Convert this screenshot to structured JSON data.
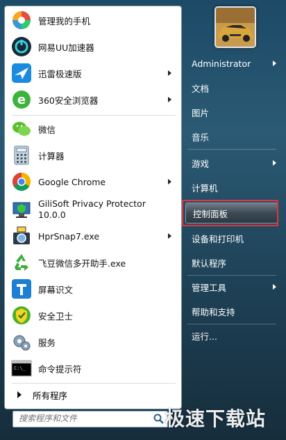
{
  "programs": [
    {
      "label": "管理我的手机",
      "icon": "colorful-circle-icon"
    },
    {
      "label": "网易UU加速器",
      "icon": "uu-accelerator-icon"
    },
    {
      "label": "迅雷极速版",
      "icon": "thunder-bird-icon",
      "submenu": true
    },
    {
      "label": "360安全浏览器",
      "icon": "ie-e-icon",
      "submenu": true
    },
    {
      "label": "微信",
      "icon": "wechat-icon"
    },
    {
      "label": "计算器",
      "icon": "calculator-icon"
    },
    {
      "label": "Google Chrome",
      "icon": "chrome-icon",
      "submenu": true
    },
    {
      "label": "GiliSoft Privacy Protector",
      "label2": "10.0.0",
      "icon": "privacy-protector-icon"
    },
    {
      "label": "HprSnap7.exe",
      "icon": "hypersnap-icon",
      "submenu": true
    },
    {
      "label": "飞豆微信多开助手.exe",
      "icon": "recycle-icon"
    },
    {
      "label": "屏幕识文",
      "icon": "t-text-icon"
    },
    {
      "label": "安全卫士",
      "icon": "security-guard-icon"
    },
    {
      "label": "服务",
      "icon": "gear-service-icon"
    },
    {
      "label": "命令提示符",
      "icon": "cmd-icon"
    }
  ],
  "all_programs": "所有程序",
  "search": {
    "placeholder": "搜索程序和文件"
  },
  "right_menu": [
    {
      "label": "Administrator",
      "submenu": true
    },
    {
      "label": "文档"
    },
    {
      "label": "图片"
    },
    {
      "label": "音乐"
    },
    {
      "label": "游戏",
      "submenu": true
    },
    {
      "label": "计算机"
    },
    {
      "label": "控制面板",
      "highlighted": true
    },
    {
      "label": "设备和打印机"
    },
    {
      "label": "默认程序"
    },
    {
      "label": "管理工具",
      "submenu": true
    },
    {
      "label": "帮助和支持"
    },
    {
      "label": "运行..."
    }
  ],
  "watermark": "极速下载站",
  "colors": {
    "highlight_border": "#e0353a",
    "menu_bg": "#1e4156"
  }
}
